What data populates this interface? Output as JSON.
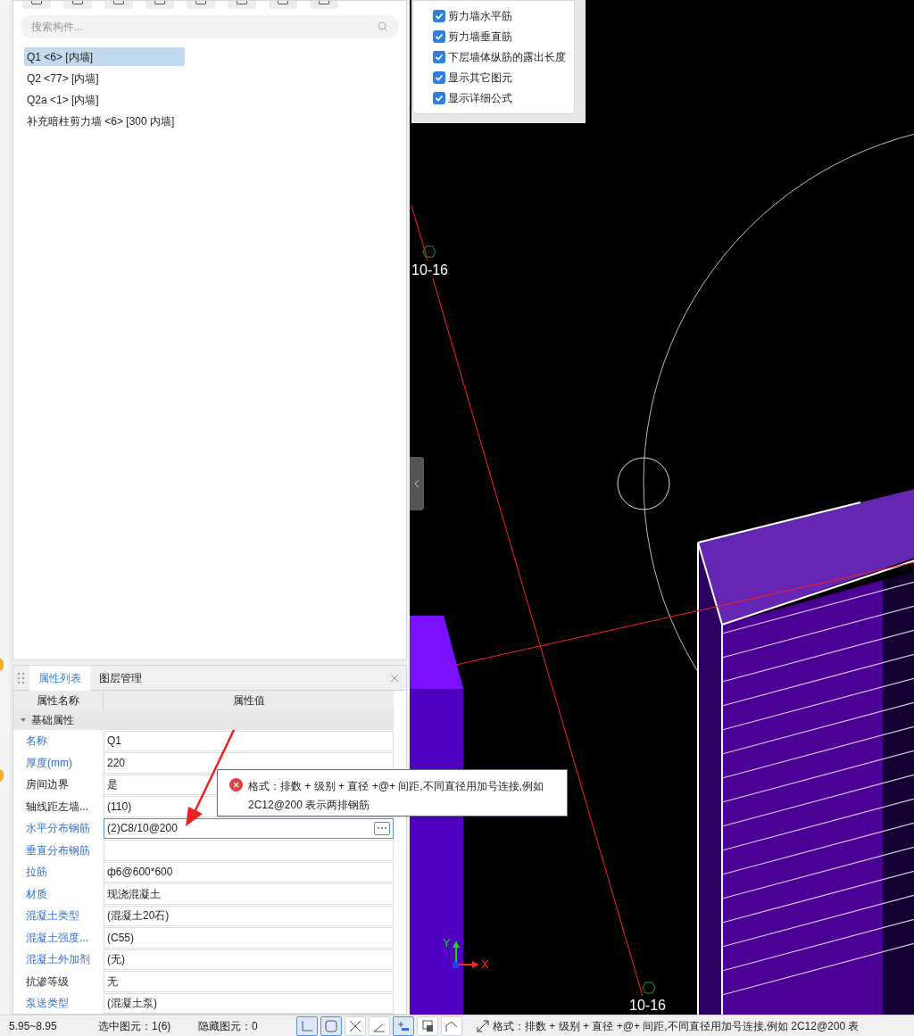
{
  "search": {
    "placeholder": "搜索构件..."
  },
  "components": [
    {
      "label": "Q1 <6> [内墙]",
      "selected": true
    },
    {
      "label": "Q2 <77> [内墙]",
      "selected": false
    },
    {
      "label": "Q2a <1> [内墙]",
      "selected": false
    },
    {
      "label": "补充暗柱剪力墙 <6> [300 内墙]",
      "selected": false
    }
  ],
  "display_options": [
    {
      "label": "剪力墙水平筋",
      "checked": true
    },
    {
      "label": "剪力墙垂直筋",
      "checked": true
    },
    {
      "label": "下层墙体纵筋的露出长度",
      "checked": true
    },
    {
      "label": "显示其它图元",
      "checked": true
    },
    {
      "label": "显示详细公式",
      "checked": true
    }
  ],
  "panel_tabs": [
    {
      "label": "属性列表",
      "selected": true
    },
    {
      "label": "图层管理",
      "selected": false
    }
  ],
  "property_table": {
    "columns": [
      "属性名称",
      "属性值"
    ],
    "group": {
      "label": "基础属性",
      "expanded": true
    },
    "rows": [
      {
        "name": "名称",
        "value": "Q1",
        "public": true,
        "editing": false
      },
      {
        "name": "厚度(mm)",
        "value": "220",
        "public": true,
        "editing": false
      },
      {
        "name": "房间边界",
        "value": "是",
        "public": false,
        "editing": false
      },
      {
        "name": "轴线距左墙...",
        "value": "(110)",
        "public": false,
        "editing": false
      },
      {
        "name": "水平分布钢筋",
        "value": "(2)C8/10@200",
        "public": true,
        "editing": true
      },
      {
        "name": "垂直分布钢筋",
        "value": "",
        "public": true,
        "editing": false
      },
      {
        "name": "拉筋",
        "value": "ф6@600*600",
        "public": true,
        "editing": false
      },
      {
        "name": "材质",
        "value": "现浇混凝土",
        "public": true,
        "editing": false
      },
      {
        "name": "混凝土类型",
        "value": "(混凝土20石)",
        "public": true,
        "editing": false
      },
      {
        "name": "混凝土强度...",
        "value": "(C55)",
        "public": true,
        "editing": false
      },
      {
        "name": "混凝土外加剂",
        "value": "(无)",
        "public": true,
        "editing": false
      },
      {
        "name": "抗渗等级",
        "value": "无",
        "public": false,
        "editing": false
      },
      {
        "name": "泵送类型",
        "value": "(混凝土泵)",
        "public": true,
        "editing": false
      }
    ]
  },
  "error_tooltip": {
    "text": "格式：排数 + 级别 + 直径 +@+ 间距,不同直径用加号连接,例如 2C12@200 表示两排钢筋"
  },
  "canvas": {
    "axis_labels": [
      "10-16",
      "10-16"
    ],
    "axis_x": "X",
    "axis_y": "Y"
  },
  "status_bar": {
    "elevation": "5.95~8.95",
    "selected": "选中图元：1(6)",
    "hidden": "隐藏图元：0",
    "tools": [
      {
        "kind": "ortho",
        "on": true
      },
      {
        "kind": "select",
        "on": true
      },
      {
        "kind": "cross",
        "on": false
      },
      {
        "kind": "angle",
        "on": false
      },
      {
        "kind": "snap",
        "on": true
      },
      {
        "kind": "layer",
        "on": false
      },
      {
        "kind": "curve",
        "on": false
      }
    ],
    "message": "格式：排数 + 级别 + 直径 +@+ 间距,不同直径用加号连接,例如 2C12@200 表"
  }
}
